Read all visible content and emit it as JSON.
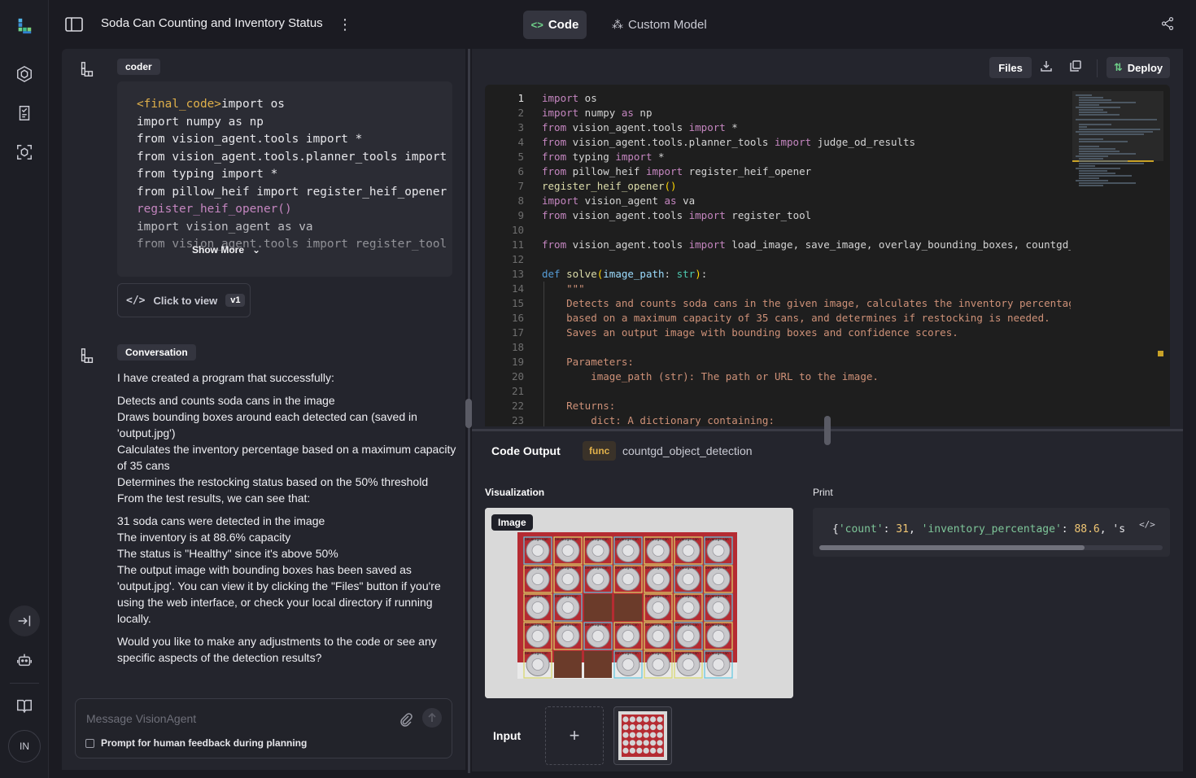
{
  "header": {
    "title": "Soda Can Counting and Inventory Status",
    "tabs": [
      {
        "label": "Code",
        "active": true
      },
      {
        "label": "Custom Model",
        "active": false
      }
    ]
  },
  "rail": {
    "avatar_initials": "IN",
    "icons": [
      "logo-icon",
      "hexagon-icon",
      "checklist-icon",
      "scan-icon",
      "collapse-icon",
      "robot-icon",
      "book-icon"
    ]
  },
  "chat": {
    "coder_tag": "coder",
    "code_preview_lines": [
      "<final_code>import os",
      "import numpy as np",
      "from vision_agent.tools import *",
      "from vision_agent.tools.planner_tools import judge_od_results",
      "from typing import *",
      "from pillow_heif import register_heif_opener",
      "register_heif_opener()",
      "import vision_agent as va",
      "from vision_agent.tools import register_tool"
    ],
    "show_more_label": "Show More",
    "click_to_view_label": "Click to view",
    "version_label": "v1",
    "conversation_tag": "Conversation",
    "conversation_paragraphs": [
      "I have created a program that successfully:",
      "",
      "Detects and counts soda cans in the image",
      "Draws bounding boxes around each detected can (saved in 'output.jpg')",
      "Calculates the inventory percentage based on a maximum capacity of 35 cans",
      "Determines the restocking status based on the 50% threshold",
      "From the test results, we can see that:",
      "",
      "31 soda cans were detected in the image",
      "The inventory is at 88.6% capacity",
      "The status is \"Healthy\" since it's above 50%",
      "The output image with bounding boxes has been saved as 'output.jpg'. You can view it by clicking the \"Files\" button if you're using the web interface, or check your local directory if running locally.",
      "",
      "Would you like to make any adjustments to the code or see any specific aspects of the detection results?"
    ],
    "composer": {
      "placeholder": "Message VisionAgent",
      "checkbox_label": "Prompt for human feedback during planning"
    }
  },
  "toolbar": {
    "files_label": "Files",
    "deploy_label": "Deploy"
  },
  "editor": {
    "line_numbers": [
      "1",
      "2",
      "3",
      "4",
      "5",
      "6",
      "7",
      "8",
      "9",
      "10",
      "11",
      "12",
      "13",
      "14",
      "15",
      "16",
      "17",
      "18",
      "19",
      "20",
      "21",
      "22",
      "23"
    ],
    "active_line": 1
  },
  "output": {
    "title": "Code Output",
    "func_badge": "func",
    "func_name": "countgd_object_detection",
    "visualization_label": "Visualization",
    "print_label": "Print",
    "image_tag": "Image",
    "print_text": "{'count': 31, 'inventory_percentage': 88.6, 's",
    "input_label": "Input",
    "add_input_symbol": "+",
    "detection_label": "beverage can",
    "detected_count": 31
  },
  "colors": {
    "accent": "#e0b04a",
    "box_cyan": "#5fc7e0",
    "box_yellow": "#d8d86a"
  }
}
